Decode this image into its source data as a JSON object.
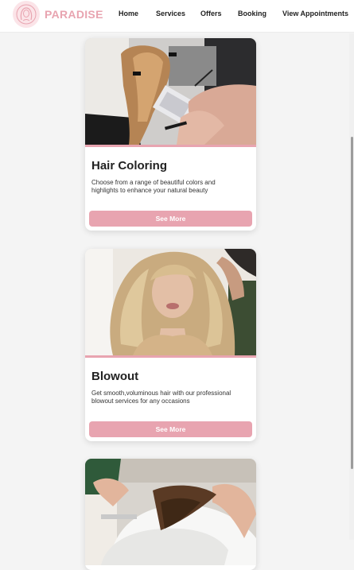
{
  "nav": {
    "brand": "PARADISE",
    "links": [
      "Home",
      "Services",
      "Offers",
      "Booking",
      "View Appointments"
    ]
  },
  "cards": [
    {
      "title": "Hair Coloring",
      "description": "Choose from a range of beautiful colors and highlights to enhance your natural beauty",
      "button": "See More"
    },
    {
      "title": "Blowout",
      "description": "Get smooth,voluminous hair with our professional blowout services for any occasions",
      "button": "See More"
    },
    {
      "title": "",
      "description": "",
      "button": ""
    }
  ],
  "colors": {
    "accent": "#e8a4b0",
    "page_background": "#f4f4f4",
    "text": "#222222"
  }
}
